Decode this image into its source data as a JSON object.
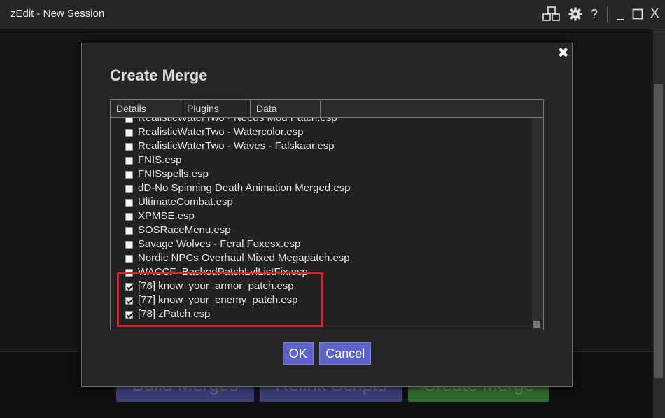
{
  "window": {
    "title": "zEdit - New Session",
    "help_glyph": "?",
    "close_glyph": "X"
  },
  "background": {
    "buttons": [
      {
        "label": "Build Merges"
      },
      {
        "label": "Relink Scripts"
      },
      {
        "label": "Create Merge"
      }
    ]
  },
  "modal": {
    "title": "Create Merge",
    "close_glyph": "✖",
    "tabs": [
      {
        "label": "Details"
      },
      {
        "label": "Plugins"
      },
      {
        "label": "Data"
      }
    ],
    "active_tab": "Plugins",
    "plugins": [
      {
        "label": "RealisticWaterTwo - Needs Mod Patch.esp",
        "checked": false
      },
      {
        "label": "RealisticWaterTwo - Watercolor.esp",
        "checked": false
      },
      {
        "label": "RealisticWaterTwo - Waves - Falskaar.esp",
        "checked": false
      },
      {
        "label": "FNIS.esp",
        "checked": false
      },
      {
        "label": "FNISspells.esp",
        "checked": false
      },
      {
        "label": "dD-No Spinning Death Animation Merged.esp",
        "checked": false
      },
      {
        "label": "UltimateCombat.esp",
        "checked": false
      },
      {
        "label": "XPMSE.esp",
        "checked": false
      },
      {
        "label": "SOSRaceMenu.esp",
        "checked": false
      },
      {
        "label": "Savage Wolves - Feral Foxesx.esp",
        "checked": false
      },
      {
        "label": "Nordic NPCs Overhaul Mixed Megapatch.esp",
        "checked": false
      },
      {
        "label": "WACCF_BashedPatchLvlListFix.esp",
        "checked": false
      },
      {
        "label": "[76] know_your_armor_patch.esp",
        "checked": true
      },
      {
        "label": "[77] know_your_enemy_patch.esp",
        "checked": true
      },
      {
        "label": "[78] zPatch.esp",
        "checked": true
      }
    ],
    "ok_label": "OK",
    "cancel_label": "Cancel"
  },
  "colors": {
    "accent": "#5d63c9",
    "highlight": "#e0202a",
    "green_button": "#49a545"
  }
}
